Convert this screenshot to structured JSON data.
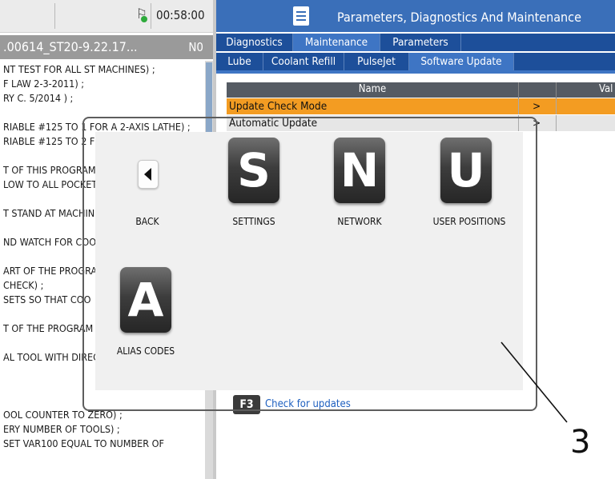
{
  "status": {
    "clock": "00:58:00"
  },
  "program": {
    "name": ".00614_ST20-9.22.17...",
    "n_label": "N0",
    "lines": [
      "NT TEST FOR ALL ST MACHINES) ;",
      "F LAW 2-3-2011) ;",
      "RY C. 5/2014 ) ;",
      "",
      "RIABLE #125 TO 1 FOR A 2-AXIS LATHE) ;",
      "RIABLE #125 TO 2 F",
      "",
      "T OF THIS PROGRAM",
      "LOW TO ALL POCKET",
      "",
      "T STAND AT MACHIN",
      "",
      "ND WATCH FOR COO",
      "",
      "ART OF THE PROGRA",
      "CHECK) ;",
      "SETS SO THAT COO",
      "",
      "T OF THE PROGRAM",
      "",
      "AL TOOL WITH DIREC",
      "",
      "",
      "",
      "OOL COUNTER TO ZERO) ;",
      "ERY NUMBER OF TOOLS) ;",
      "SET VAR100 EQUAL TO NUMBER OF"
    ]
  },
  "header": {
    "title": "Parameters, Diagnostics And Maintenance"
  },
  "tabs_row1": [
    "Diagnostics",
    "Maintenance",
    "Parameters"
  ],
  "tabs_row2": [
    "Lube",
    "Coolant Refill",
    "PulseJet",
    "Software Update"
  ],
  "table": {
    "col_name": "Name",
    "col_value": "Val",
    "rows": [
      {
        "name": "Update Check Mode",
        "arrow": ">"
      },
      {
        "name": "Automatic Update",
        "arrow": ">"
      }
    ]
  },
  "f3": {
    "key": "F3",
    "label": "Check for updates"
  },
  "popup": {
    "items": [
      {
        "letter": "",
        "label": "BACK"
      },
      {
        "letter": "S",
        "label": "SETTINGS"
      },
      {
        "letter": "N",
        "label": "NETWORK"
      },
      {
        "letter": "U",
        "label": "USER POSITIONS"
      },
      {
        "letter": "A",
        "label": "ALIAS CODES"
      }
    ]
  },
  "callout": "3",
  "colors": {
    "header_blue": "#3a6fb9",
    "tab_blue": "#1d4f9a",
    "selected_row": "#f39c22",
    "link_blue": "#1e5fbf"
  }
}
